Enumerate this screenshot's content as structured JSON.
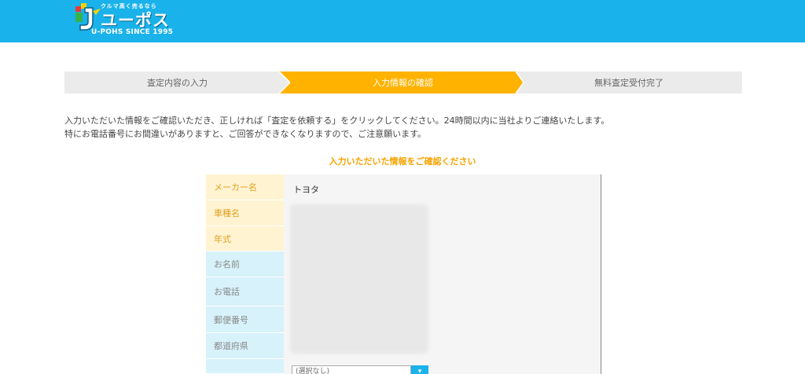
{
  "header": {
    "logo_tagline": "クルマ高く売るなら",
    "logo_name": "ユーポス",
    "logo_since": "U-POHS SINCE 1995",
    "background_color": "#1ab2ea"
  },
  "steps": [
    {
      "label": "査定内容の入力",
      "active": false
    },
    {
      "label": "入力情報の確認",
      "active": true
    },
    {
      "label": "無料査定受付完了",
      "active": false
    }
  ],
  "intro": {
    "line1": "入力いただいた情報をご確認いただき、正しければ「査定を依頼する」をクリックしてください。24時間以内に当社よりご連絡いたします。",
    "line2": "特にお電話番号にお間違いがありますと、ご回答ができなくなりますので、ご注意願います。"
  },
  "confirm_title": "入力いただいた情報をご確認ください",
  "table": {
    "labels": [
      "メーカー名",
      "車種名",
      "年式",
      "お名前",
      "お電話",
      "郵便番号",
      "都道府県"
    ],
    "maker_value": "トヨタ",
    "select_value": "(選択なし)"
  },
  "colors": {
    "accent": "#ffb300",
    "brand": "#1ab2ea",
    "car_label_bg": "#fff3d1",
    "person_label_bg": "#d8f2fb"
  }
}
